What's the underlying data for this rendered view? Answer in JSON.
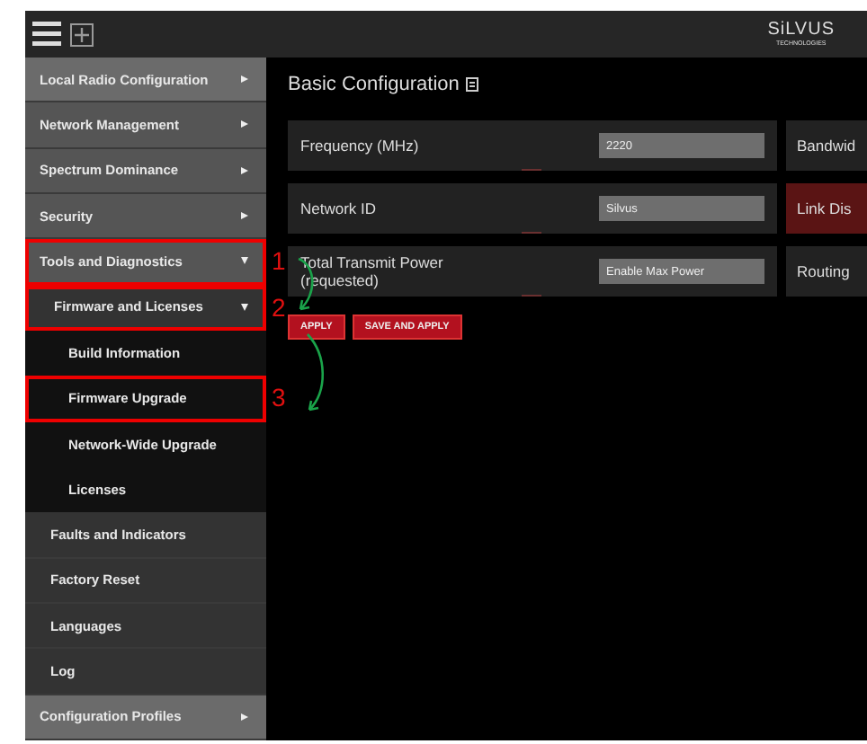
{
  "header": {
    "logo": {
      "name": "SiLVUS",
      "tagline": "TECHNOLOGIES"
    }
  },
  "sidebar": {
    "items": [
      {
        "label": "Local Radio Configuration",
        "expanded": false,
        "highlighted": true
      },
      {
        "label": "Network Management",
        "expanded": false,
        "highlighted": false
      },
      {
        "label": "Spectrum Dominance",
        "expanded": false,
        "highlighted": false
      },
      {
        "label": "Security",
        "expanded": false,
        "highlighted": false
      },
      {
        "label": "Tools and Diagnostics",
        "expanded": true,
        "highlighted": false,
        "callout": "1",
        "children": [
          {
            "label": "Firmware and Licenses",
            "expanded": true,
            "callout": "2",
            "children": [
              {
                "label": "Build Information"
              },
              {
                "label": "Firmware Upgrade",
                "callout": "3"
              },
              {
                "label": "Network-Wide Upgrade"
              },
              {
                "label": "Licenses"
              }
            ]
          },
          {
            "label": "Faults and Indicators"
          },
          {
            "label": "Factory Reset"
          },
          {
            "label": "Languages"
          },
          {
            "label": "Log"
          }
        ]
      },
      {
        "label": "Configuration Profiles",
        "expanded": false,
        "highlighted": true
      }
    ]
  },
  "main": {
    "title": "Basic Configuration",
    "fields": [
      {
        "label": "Frequency (MHz)",
        "value": "2220"
      },
      {
        "label": "Network ID",
        "value": "Silvus"
      },
      {
        "label": "Total Transmit Power (requested)",
        "value": "Enable Max Power"
      }
    ],
    "side_cards": [
      {
        "label": "Bandwid",
        "alert": false
      },
      {
        "label": "Link Dis",
        "alert": true
      },
      {
        "label": "Routing",
        "alert": false
      }
    ],
    "buttons": [
      "APPLY",
      "SAVE AND APPLY"
    ]
  }
}
